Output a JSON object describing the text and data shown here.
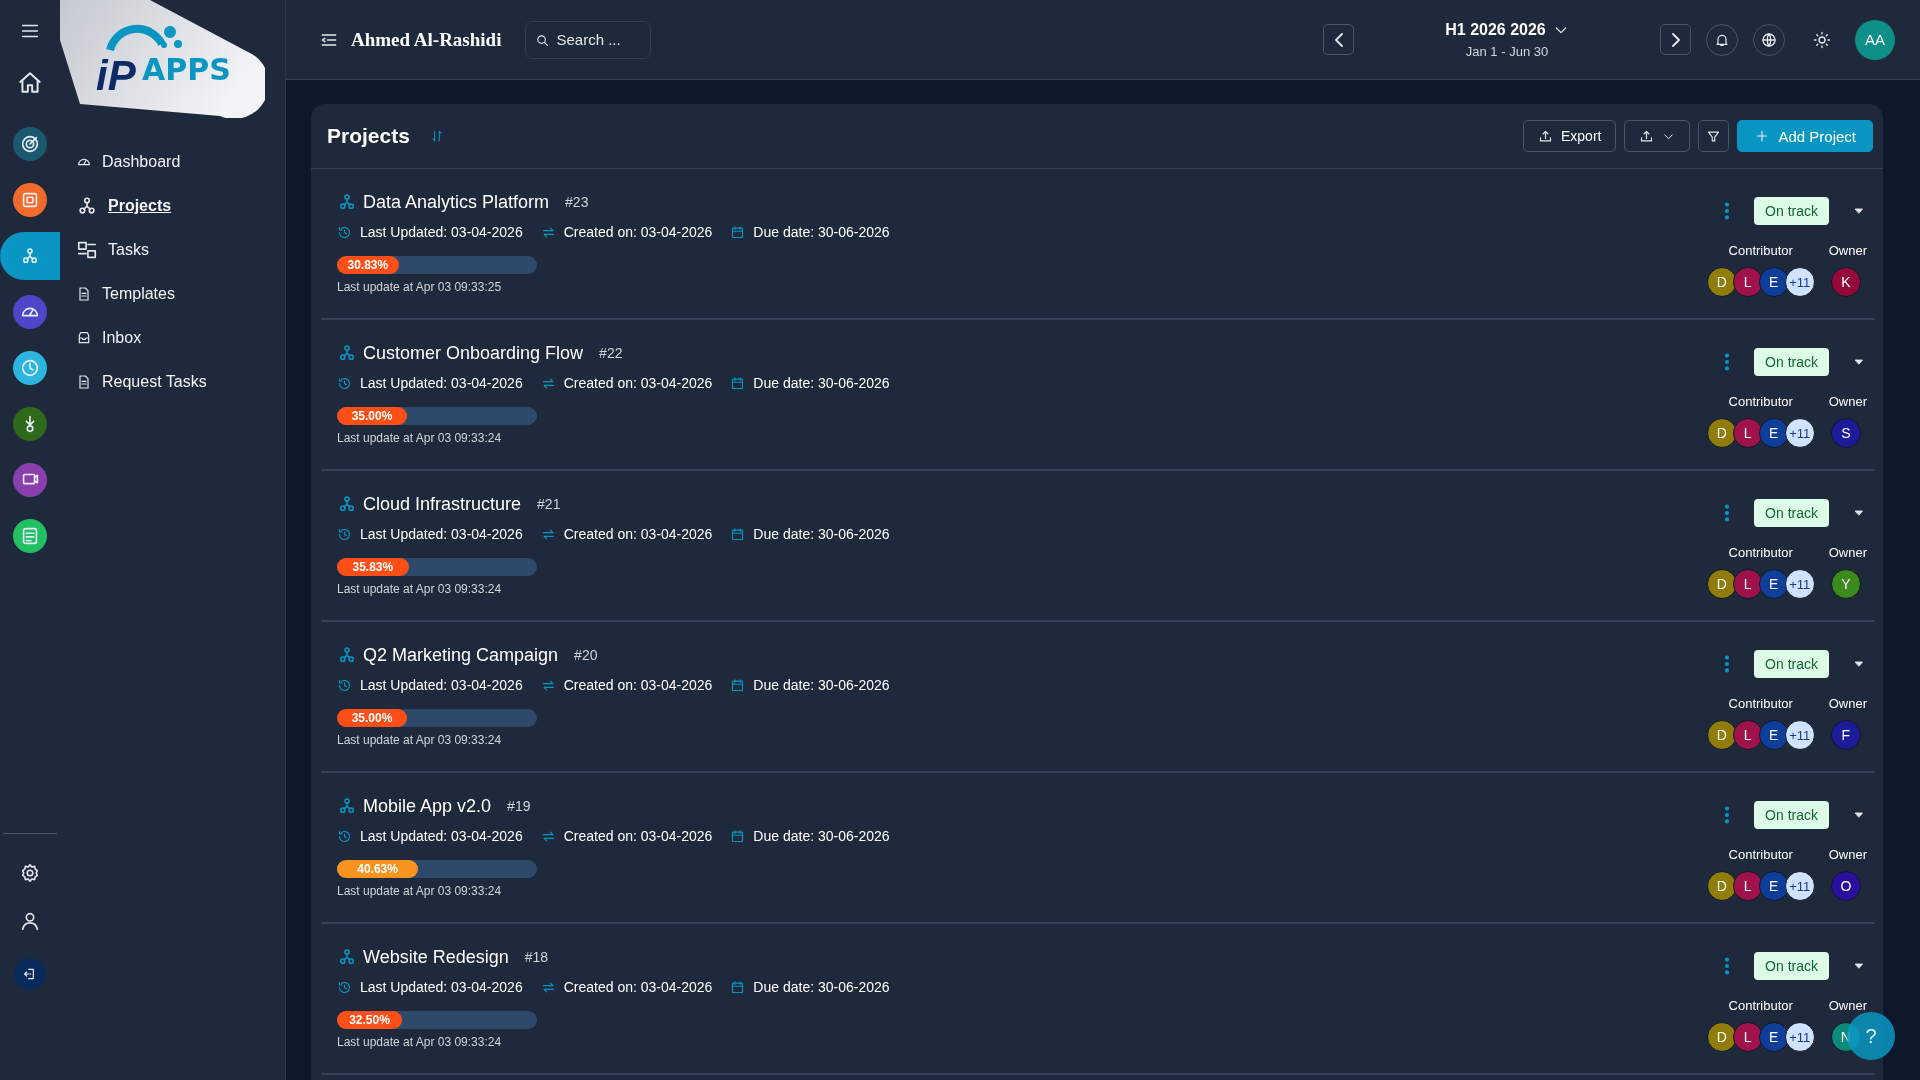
{
  "rail": {
    "items": [
      {
        "color": "#1b5a6e",
        "selected": false
      },
      {
        "color": "#f26a2c",
        "selected": false
      },
      {
        "color": "#0a96c3",
        "selected": true
      },
      {
        "color": "#4d46c9",
        "selected": false
      },
      {
        "color": "#2bb5df",
        "selected": false
      },
      {
        "color": "#2f6a1c",
        "selected": false
      },
      {
        "color": "#8b3fae",
        "selected": false
      },
      {
        "color": "#21c063",
        "selected": false
      }
    ]
  },
  "logo": {
    "mark": "iP",
    "text": "APPS"
  },
  "nav": [
    {
      "label": "Dashboard",
      "selected": false
    },
    {
      "label": "Projects",
      "selected": true
    },
    {
      "label": "Tasks",
      "selected": false
    },
    {
      "label": "Templates",
      "selected": false
    },
    {
      "label": "Inbox",
      "selected": false
    },
    {
      "label": "Request Tasks",
      "selected": false
    }
  ],
  "header": {
    "user": "Ahmed Al-Rashidi",
    "search": {
      "placeholder": "Search ..."
    },
    "period": {
      "title": "H1 2026 2026",
      "range": "Jan 1 - Jun 30"
    },
    "avatar": "AA"
  },
  "projects": {
    "title": "Projects",
    "export": "Export",
    "add": "Add Project",
    "rows": [
      {
        "name": "Data Analytics Platform",
        "number": "#23",
        "last_updated": "Last Updated: 03-04-2026",
        "created": "Created on: 03-04-2026",
        "due": "Due date: 30-06-2026",
        "progress": {
          "level": 0.3083,
          "label": "30.83%",
          "color": "#ff4f17"
        },
        "last_update": "Last update at Apr 03 09:33:25",
        "status": "On track",
        "contributor_label": "Contributor",
        "owner_label": "Owner",
        "contributors": [
          {
            "initial": "D",
            "color": "#8f7c0a"
          },
          {
            "initial": "L",
            "color": "#a0124a"
          },
          {
            "initial": "E",
            "color": "#0e3e9a"
          }
        ],
        "more": "+11",
        "owner": {
          "initial": "K",
          "color": "#95093a"
        }
      },
      {
        "name": "Customer Onboarding Flow",
        "number": "#22",
        "last_updated": "Last Updated: 03-04-2026",
        "created": "Created on: 03-04-2026",
        "due": "Due date: 30-06-2026",
        "progress": {
          "level": 0.35,
          "label": "35.00%",
          "color": "#ff4f17"
        },
        "last_update": "Last update at Apr 03 09:33:24",
        "status": "On track",
        "contributor_label": "Contributor",
        "owner_label": "Owner",
        "contributors": [
          {
            "initial": "D",
            "color": "#8f7c0a"
          },
          {
            "initial": "L",
            "color": "#a0124a"
          },
          {
            "initial": "E",
            "color": "#0e3e9a"
          }
        ],
        "more": "+11",
        "owner": {
          "initial": "S",
          "color": "#1c1c9a"
        }
      },
      {
        "name": "Cloud Infrastructure",
        "number": "#21",
        "last_updated": "Last Updated: 03-04-2026",
        "created": "Created on: 03-04-2026",
        "due": "Due date: 30-06-2026",
        "progress": {
          "level": 0.3583,
          "label": "35.83%",
          "color": "#ff4f17"
        },
        "last_update": "Last update at Apr 03 09:33:24",
        "status": "On track",
        "contributor_label": "Contributor",
        "owner_label": "Owner",
        "contributors": [
          {
            "initial": "D",
            "color": "#8f7c0a"
          },
          {
            "initial": "L",
            "color": "#a0124a"
          },
          {
            "initial": "E",
            "color": "#0e3e9a"
          }
        ],
        "more": "+11",
        "owner": {
          "initial": "Y",
          "color": "#3b8a1c"
        }
      },
      {
        "name": "Q2 Marketing Campaign",
        "number": "#20",
        "last_updated": "Last Updated: 03-04-2026",
        "created": "Created on: 03-04-2026",
        "due": "Due date: 30-06-2026",
        "progress": {
          "level": 0.35,
          "label": "35.00%",
          "color": "#ff4f17"
        },
        "last_update": "Last update at Apr 03 09:33:24",
        "status": "On track",
        "contributor_label": "Contributor",
        "owner_label": "Owner",
        "contributors": [
          {
            "initial": "D",
            "color": "#8f7c0a"
          },
          {
            "initial": "L",
            "color": "#a0124a"
          },
          {
            "initial": "E",
            "color": "#0e3e9a"
          }
        ],
        "more": "+11",
        "owner": {
          "initial": "F",
          "color": "#1c1c9a"
        }
      },
      {
        "name": "Mobile App v2.0",
        "number": "#19",
        "last_updated": "Last Updated: 03-04-2026",
        "created": "Created on: 03-04-2026",
        "due": "Due date: 30-06-2026",
        "progress": {
          "level": 0.4063,
          "label": "40.63%",
          "color": "#f7931e"
        },
        "last_update": "Last update at Apr 03 09:33:24",
        "status": "On track",
        "contributor_label": "Contributor",
        "owner_label": "Owner",
        "contributors": [
          {
            "initial": "D",
            "color": "#8f7c0a"
          },
          {
            "initial": "L",
            "color": "#a0124a"
          },
          {
            "initial": "E",
            "color": "#0e3e9a"
          }
        ],
        "more": "+11",
        "owner": {
          "initial": "O",
          "color": "#2a0ea0"
        }
      },
      {
        "name": "Website Redesign",
        "number": "#18",
        "last_updated": "Last Updated: 03-04-2026",
        "created": "Created on: 03-04-2026",
        "due": "Due date: 30-06-2026",
        "progress": {
          "level": 0.325,
          "label": "32.50%",
          "color": "#ff4f17"
        },
        "last_update": "Last update at Apr 03 09:33:24",
        "status": "On track",
        "contributor_label": "Contributor",
        "owner_label": "Owner",
        "contributors": [
          {
            "initial": "D",
            "color": "#8f7c0a"
          },
          {
            "initial": "L",
            "color": "#a0124a"
          },
          {
            "initial": "E",
            "color": "#0e3e9a"
          }
        ],
        "more": "+11",
        "owner": {
          "initial": "N",
          "color": "#0e8a78"
        }
      }
    ]
  },
  "help": "?"
}
